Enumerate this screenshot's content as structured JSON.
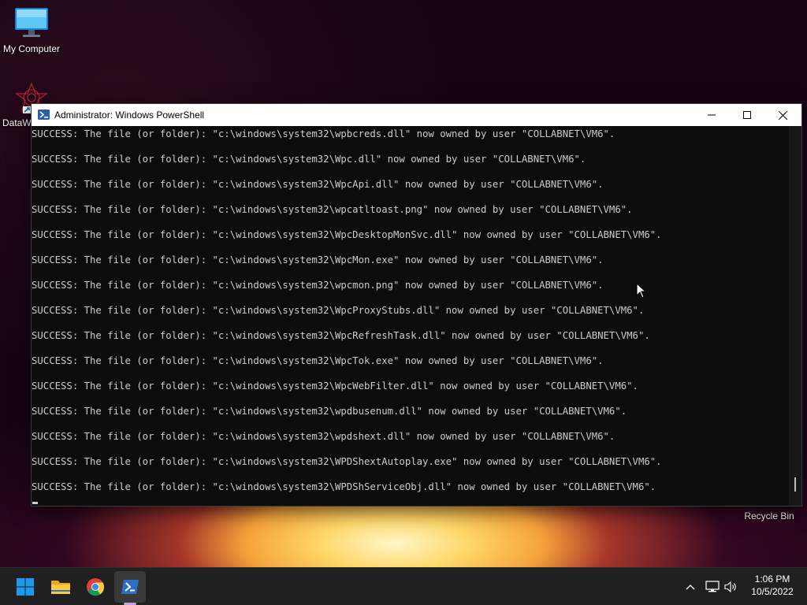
{
  "desktop": {
    "icons": [
      {
        "label": "My Computer"
      },
      {
        "label": "DataW"
      },
      {
        "label": "Recycle Bin"
      }
    ]
  },
  "window": {
    "title": "Administrator: Windows PowerShell",
    "lines": [
      "SUCCESS: The file (or folder): \"c:\\windows\\system32\\wpbcreds.dll\" now owned by user \"COLLABNET\\VM6\".",
      "SUCCESS: The file (or folder): \"c:\\windows\\system32\\Wpc.dll\" now owned by user \"COLLABNET\\VM6\".",
      "SUCCESS: The file (or folder): \"c:\\windows\\system32\\WpcApi.dll\" now owned by user \"COLLABNET\\VM6\".",
      "SUCCESS: The file (or folder): \"c:\\windows\\system32\\wpcatltoast.png\" now owned by user \"COLLABNET\\VM6\".",
      "SUCCESS: The file (or folder): \"c:\\windows\\system32\\WpcDesktopMonSvc.dll\" now owned by user \"COLLABNET\\VM6\".",
      "SUCCESS: The file (or folder): \"c:\\windows\\system32\\WpcMon.exe\" now owned by user \"COLLABNET\\VM6\".",
      "SUCCESS: The file (or folder): \"c:\\windows\\system32\\wpcmon.png\" now owned by user \"COLLABNET\\VM6\".",
      "SUCCESS: The file (or folder): \"c:\\windows\\system32\\WpcProxyStubs.dll\" now owned by user \"COLLABNET\\VM6\".",
      "SUCCESS: The file (or folder): \"c:\\windows\\system32\\WpcRefreshTask.dll\" now owned by user \"COLLABNET\\VM6\".",
      "SUCCESS: The file (or folder): \"c:\\windows\\system32\\WpcTok.exe\" now owned by user \"COLLABNET\\VM6\".",
      "SUCCESS: The file (or folder): \"c:\\windows\\system32\\WpcWebFilter.dll\" now owned by user \"COLLABNET\\VM6\".",
      "SUCCESS: The file (or folder): \"c:\\windows\\system32\\wpdbusenum.dll\" now owned by user \"COLLABNET\\VM6\".",
      "SUCCESS: The file (or folder): \"c:\\windows\\system32\\wpdshext.dll\" now owned by user \"COLLABNET\\VM6\".",
      "SUCCESS: The file (or folder): \"c:\\windows\\system32\\WPDShextAutoplay.exe\" now owned by user \"COLLABNET\\VM6\".",
      "SUCCESS: The file (or folder): \"c:\\windows\\system32\\WPDShServiceObj.dll\" now owned by user \"COLLABNET\\VM6\"."
    ]
  },
  "taskbar": {
    "apps": [
      {
        "name": "start",
        "icon": "windows-logo-icon"
      },
      {
        "name": "file-explorer",
        "icon": "folder-icon"
      },
      {
        "name": "chrome",
        "icon": "chrome-icon"
      },
      {
        "name": "powershell",
        "icon": "powershell-icon",
        "active": true
      }
    ],
    "clock": {
      "time": "1:06 PM",
      "date": "10/5/2022"
    }
  },
  "colors": {
    "terminal_bg": "#0c0c0c",
    "terminal_fg": "#cccccc",
    "taskbar_bg": "#202020",
    "start_blue": "#1a9bf0"
  }
}
